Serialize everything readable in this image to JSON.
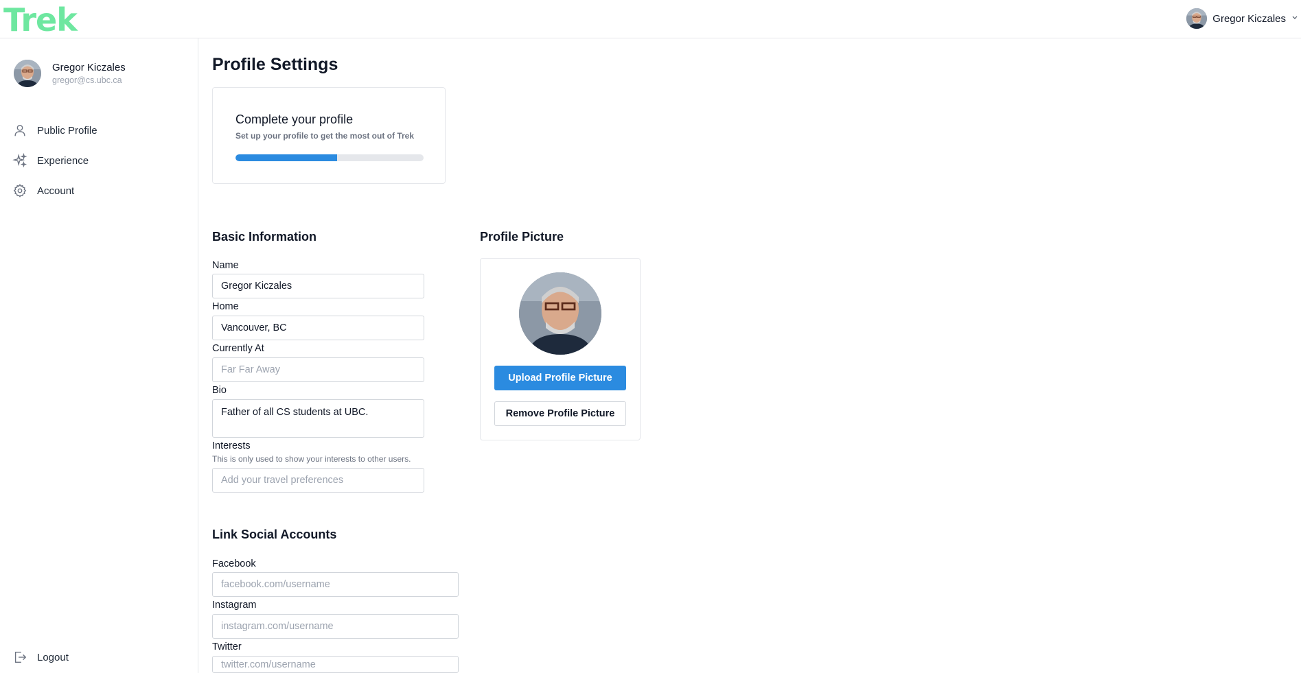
{
  "app": {
    "logo": "Trek"
  },
  "header": {
    "user_name": "Gregor Kiczales"
  },
  "sidebar": {
    "user_name": "Gregor Kiczales",
    "user_email": "gregor@cs.ubc.ca",
    "items": [
      {
        "label": "Public Profile",
        "icon": "user-icon"
      },
      {
        "label": "Experience",
        "icon": "sparkles-icon"
      },
      {
        "label": "Account",
        "icon": "gear-icon"
      }
    ],
    "logout_label": "Logout"
  },
  "main": {
    "title": "Profile Settings",
    "completion": {
      "title": "Complete your profile",
      "subtitle": "Set up your profile to get the most out of Trek",
      "progress_fraction": 0.54
    },
    "basic": {
      "section_title": "Basic Information",
      "name_label": "Name",
      "name_value": "Gregor Kiczales",
      "home_label": "Home",
      "home_value": "Vancouver, BC",
      "current_label": "Currently At",
      "current_placeholder": "Far Far Away",
      "bio_label": "Bio",
      "bio_value": "Father of all CS students at UBC.",
      "interests_label": "Interests",
      "interests_hint": "This is only used to show your interests to other users.",
      "interests_placeholder": "Add your travel preferences"
    },
    "picture": {
      "section_title": "Profile Picture",
      "upload_label": "Upload Profile Picture",
      "remove_label": "Remove Profile Picture"
    },
    "social": {
      "section_title": "Link Social Accounts",
      "facebook_label": "Facebook",
      "facebook_placeholder": "facebook.com/username",
      "instagram_label": "Instagram",
      "instagram_placeholder": "instagram.com/username",
      "twitter_label": "Twitter",
      "twitter_placeholder": "twitter.com/username"
    }
  },
  "colors": {
    "brand": "#6ee7a0",
    "accent": "#2b8be0"
  }
}
